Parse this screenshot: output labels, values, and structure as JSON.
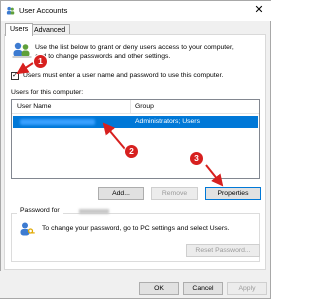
{
  "window": {
    "title": "User Accounts",
    "close_glyph": "✕"
  },
  "tabs": [
    {
      "label": "Users",
      "active": true
    },
    {
      "label": "Advanced",
      "active": false
    }
  ],
  "intro": {
    "line1": "Use the list below to grant or deny users access to your computer,",
    "line2": "and to change passwords and other settings."
  },
  "checkbox": {
    "label": "Users must enter a user name and password to use this computer.",
    "checked": true,
    "mark": "✓"
  },
  "users_list": {
    "label": "Users for this computer:",
    "columns": [
      "User Name",
      "Group"
    ],
    "rows": [
      {
        "user": "",
        "group": "Administrators; Users",
        "selected": true
      }
    ]
  },
  "list_buttons": {
    "add": "Add...",
    "remove": "Remove",
    "properties": "Properties"
  },
  "password": {
    "legend": "Password for",
    "text": "To change your password, go to PC settings and select Users.",
    "reset": "Reset Password..."
  },
  "dialog_buttons": {
    "ok": "OK",
    "cancel": "Cancel",
    "apply": "Apply"
  },
  "markers": [
    "1",
    "2",
    "3"
  ],
  "colors": {
    "selection": "#0078d7",
    "marker": "#d7201f"
  }
}
